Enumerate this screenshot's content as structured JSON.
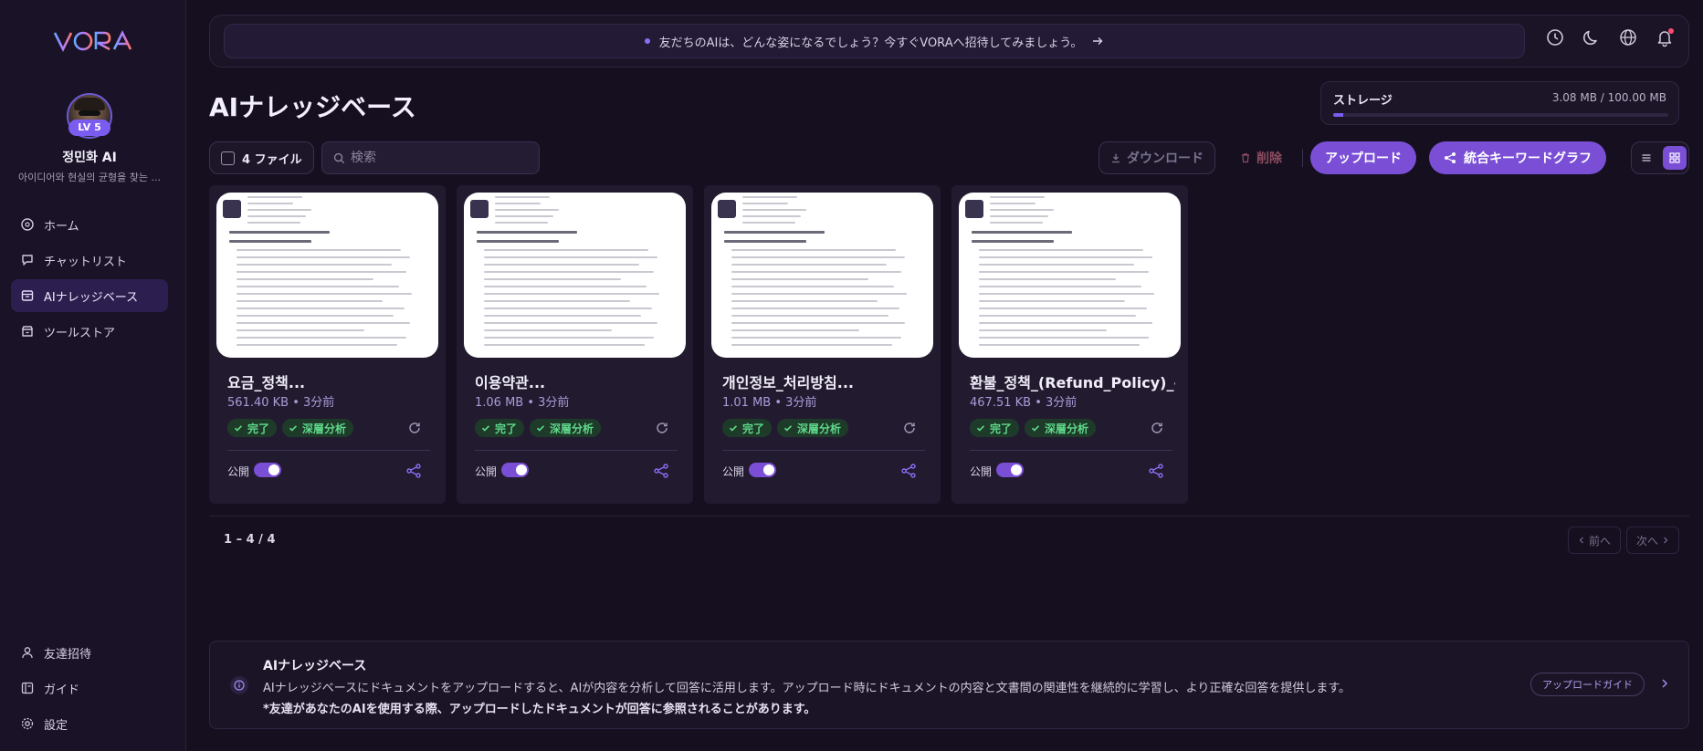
{
  "app": {
    "logo_text": "VORA"
  },
  "profile": {
    "level": "LV 5",
    "name": "정민화 AI",
    "description": "아이디어와 현실의 균형을 찾는 ..."
  },
  "sidebar": {
    "items": [
      {
        "label": "ホーム",
        "icon": "home-icon"
      },
      {
        "label": "チャットリスト",
        "icon": "chat-icon"
      },
      {
        "label": "AIナレッジベース",
        "icon": "knowledge-icon",
        "active": true
      },
      {
        "label": "ツールストア",
        "icon": "store-icon"
      }
    ],
    "bottom_items": [
      {
        "label": "友達招待",
        "icon": "user-icon"
      },
      {
        "label": "ガイド",
        "icon": "book-icon"
      },
      {
        "label": "設定",
        "icon": "gear-icon"
      }
    ]
  },
  "header": {
    "banner_text": "友だちのAIは、どんな姿になるでしょう？今すぐVORAへ招待してみましょう。",
    "icons": [
      "clock-icon",
      "moon-icon",
      "globe-icon",
      "bell-icon"
    ]
  },
  "page": {
    "title": "AIナレッジベース"
  },
  "storage": {
    "label": "ストレージ",
    "value": "3.08 MB / 100.00 MB",
    "used_fraction": 0.0308
  },
  "toolbar": {
    "file_count": "4 ファイル",
    "search_placeholder": "検索",
    "download_label": "ダウンロード",
    "delete_label": "削除",
    "upload_label": "アップロード",
    "graph_label": "統合キーワードグラフ"
  },
  "files": [
    {
      "title": "요금_정책...",
      "meta": "561.40 KB • 3分前",
      "status": "完了",
      "analysis": "深層分析",
      "public_label": "公開",
      "public": true,
      "thumb_heading": "1. 가격 구조 (Pricing Model)"
    },
    {
      "title": "이용약관...",
      "meta": "1.06 MB • 3分前",
      "status": "完了",
      "analysis": "深層分析",
      "public_label": "公開",
      "public": true,
      "thumb_heading": "1. 목적"
    },
    {
      "title": "개인정보_처리방침...",
      "meta": "1.01 MB • 3分前",
      "status": "完了",
      "analysis": "深層分析",
      "public_label": "公開",
      "public": true,
      "thumb_heading": "1. 수집하는 개인정보 항목"
    },
    {
      "title": "환불_정책_(Refund_Policy)_-...",
      "meta": "467.51 KB • 3分前",
      "status": "完了",
      "analysis": "深層分析",
      "public_label": "公開",
      "public": true,
      "thumb_heading": "1. 환불 가능 조건 (Refund Eligibility)"
    }
  ],
  "pagination": {
    "range": "1 – 4 / 4",
    "prev": "前へ",
    "next": "次へ"
  },
  "info": {
    "title": "AIナレッジベース",
    "body": "AIナレッジベースにドキュメントをアップロードすると、AIが内容を分析して回答に活用します。アップロード時にドキュメントの内容と文書間の関連性を継続的に学習し、より正確な回答を提供します。",
    "note": "*友達があなたのAIを使用する際、アップロードしたドキュメントが回答に参照されることがあります。",
    "guide_label": "アップロードガイド"
  },
  "colors": {
    "accent": "#7a4fd6",
    "status_green": "#5fd98a",
    "background": "#150f20"
  }
}
